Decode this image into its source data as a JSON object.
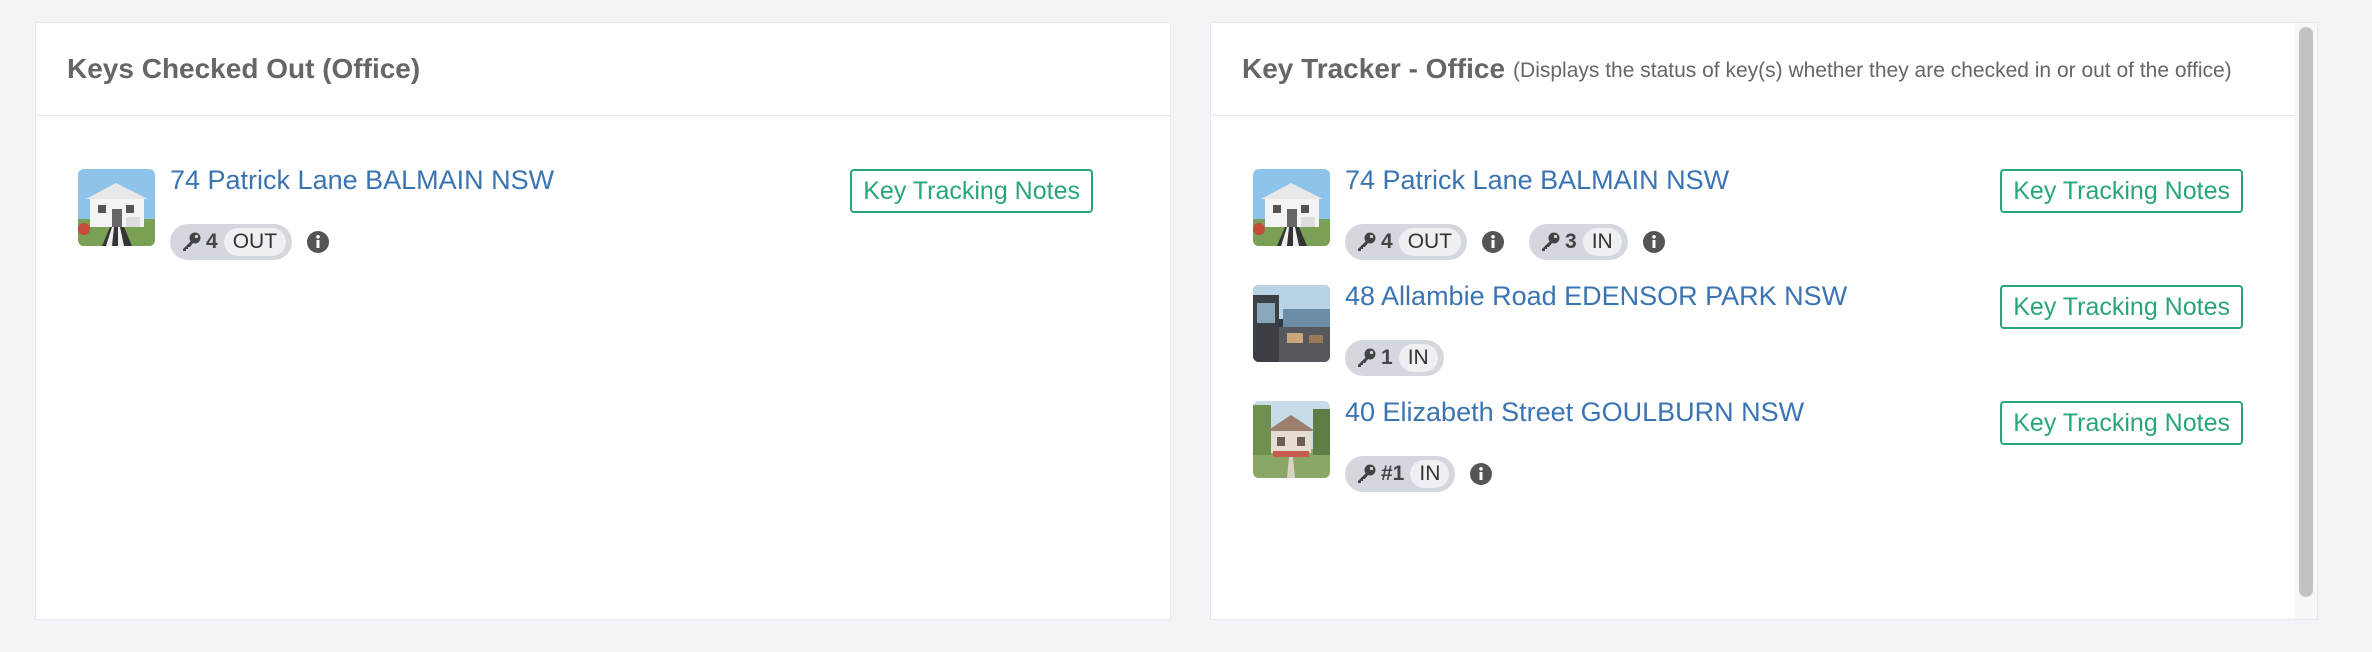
{
  "left_panel": {
    "title": "Keys Checked Out (Office)",
    "rows": [
      {
        "address": "74 Patrick Lane BALMAIN NSW",
        "notes_label": "Key Tracking Notes",
        "badges": [
          {
            "count": "4",
            "status": "OUT",
            "info": true
          }
        ]
      }
    ]
  },
  "right_panel": {
    "title": "Key Tracker - Office",
    "subtitle": "(Displays the status of key(s) whether they are checked in or out of the office)",
    "rows": [
      {
        "address": "74 Patrick Lane BALMAIN NSW",
        "notes_label": "Key Tracking Notes",
        "badges": [
          {
            "count": "4",
            "status": "OUT",
            "info": true
          },
          {
            "count": "3",
            "status": "IN",
            "info": true
          }
        ]
      },
      {
        "address": "48 Allambie Road EDENSOR PARK NSW",
        "notes_label": "Key Tracking Notes",
        "badges": [
          {
            "count": "1",
            "status": "IN",
            "info": false
          }
        ]
      },
      {
        "address": "40 Elizabeth Street GOULBURN NSW",
        "notes_label": "Key Tracking Notes",
        "badges": [
          {
            "count": "#1",
            "status": "IN",
            "info": true
          }
        ]
      }
    ]
  },
  "icons": {
    "key": "key-icon",
    "info": "info-circle-icon"
  },
  "colors": {
    "link": "#3b74b2",
    "accent_green": "#2aa57a",
    "badge_bg": "#d4d8de",
    "page_bg": "#f3f4f8"
  }
}
